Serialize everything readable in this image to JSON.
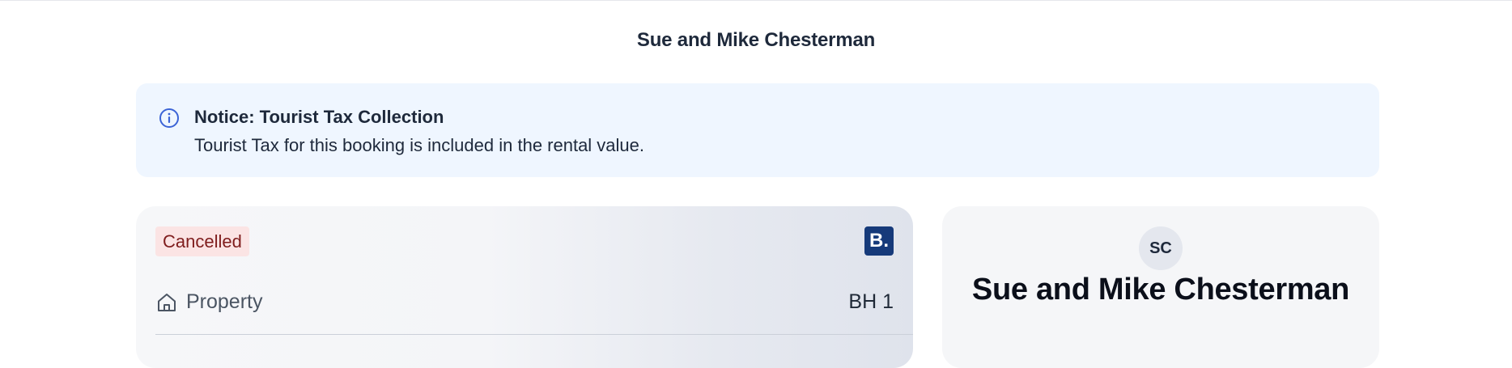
{
  "header": {
    "title": "Sue and Mike Chesterman"
  },
  "notice": {
    "icon": "info-circle-icon",
    "title": "Notice: Tourist Tax Collection",
    "body": "Tourist Tax for this booking is included in the rental value."
  },
  "booking": {
    "status": "Cancelled",
    "channel_logo": {
      "icon": "booking-com-logo",
      "letter": "B."
    },
    "property": {
      "icon": "home-icon",
      "label": "Property",
      "value": "BH 1"
    }
  },
  "guest": {
    "initials": "SC",
    "name": "Sue and Mike Chesterman"
  },
  "colors": {
    "notice_bg": "#eff6ff",
    "info_icon": "#3b63d6",
    "cancelled_bg": "#fbe4e4",
    "cancelled_text": "#7f1d1d",
    "booking_brand": "#163a7a"
  }
}
